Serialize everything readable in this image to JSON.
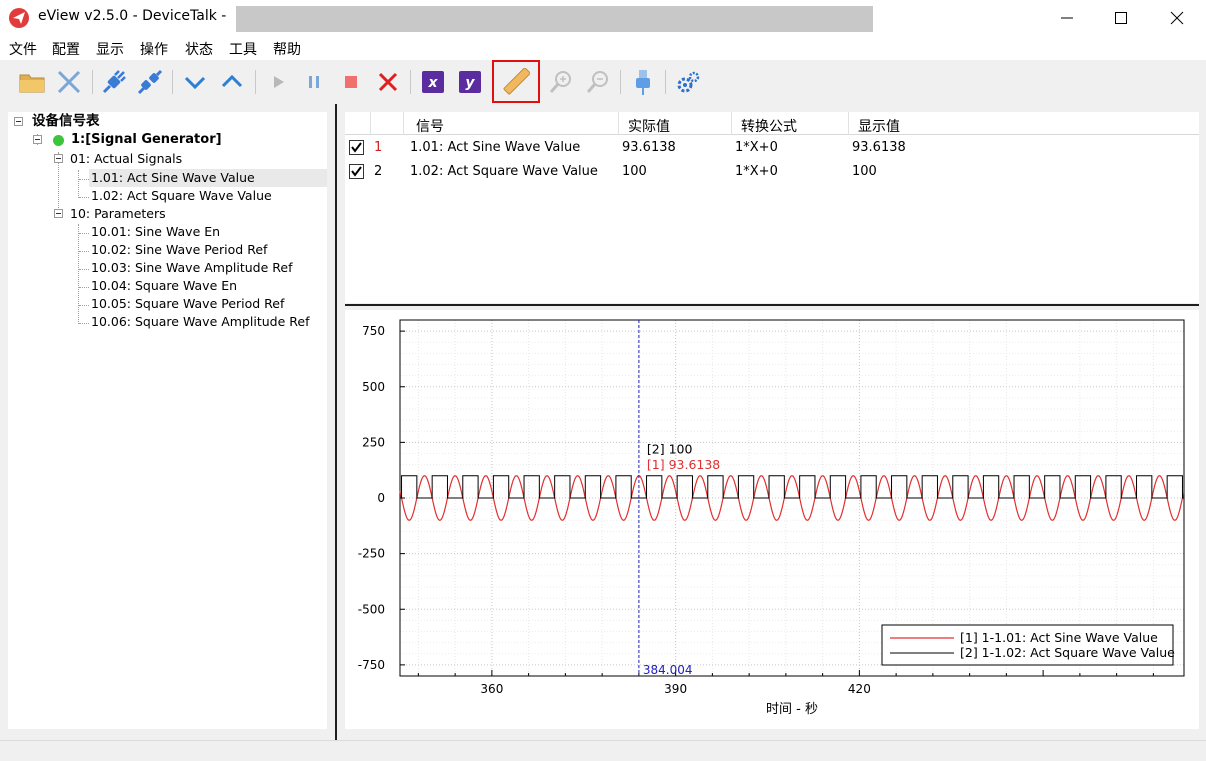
{
  "window": {
    "title": "eView v2.5.0 - DeviceTalk  -",
    "minimize_icon": "minimize-icon",
    "maximize_icon": "maximize-icon",
    "close_icon": "close-icon"
  },
  "menu": [
    "文件",
    "配置",
    "显示",
    "操作",
    "状态",
    "工具",
    "帮助"
  ],
  "toolbar": {
    "icons": [
      "open-folder-icon",
      "close-file-icon",
      "connect-icon",
      "disconnect-icon",
      "collapse-icon",
      "expand-icon",
      "play-icon",
      "pause-icon",
      "stop-icon",
      "delete-icon",
      "x-axis-icon",
      "y-axis-icon",
      "ruler-icon",
      "zoom-in-icon",
      "zoom-out-icon",
      "usb-icon",
      "settings-icon"
    ],
    "x_label": "x",
    "y_label": "y",
    "highlighted": "ruler-icon",
    "highlight_color": "#e01010"
  },
  "tree": {
    "root_label": "设备信号表",
    "device": {
      "label": "1:[Signal Generator]",
      "status_color": "#3cc43c"
    },
    "groups": [
      {
        "label": "01: Actual Signals",
        "items": [
          "1.01: Act Sine Wave Value",
          "1.02: Act Square Wave Value"
        ],
        "selected": "1.01: Act Sine Wave Value"
      },
      {
        "label": "10: Parameters",
        "items": [
          "10.01: Sine Wave En",
          "10.02: Sine Wave Period Ref",
          "10.03: Sine Wave Amplitude Ref",
          "10.04: Square Wave En",
          "10.05: Square Wave Period Ref",
          "10.06: Square Wave Amplitude Ref"
        ]
      }
    ]
  },
  "table": {
    "columns": [
      "信号",
      "实际值",
      "转换公式",
      "显示值"
    ],
    "rows": [
      {
        "checked": true,
        "index": "1",
        "index_color": "#d02020",
        "signal": "1.01: Act Sine Wave Value",
        "actual": "93.6138",
        "formula": "1*X+0",
        "display": "93.6138"
      },
      {
        "checked": true,
        "index": "2",
        "index_color": "#000000",
        "signal": "1.02: Act Square Wave Value",
        "actual": "100",
        "formula": "1*X+0",
        "display": "100"
      }
    ]
  },
  "chart_data": {
    "type": "line",
    "xlabel": "时间 - 秒",
    "ylabel": "",
    "xlim": [
      345,
      473
    ],
    "ylim": [
      -800,
      800
    ],
    "xticks": [
      360,
      390,
      420
    ],
    "yticks": [
      750,
      500,
      250,
      0,
      -250,
      -500,
      -750
    ],
    "grid": true,
    "series": [
      {
        "name": "[1] 1-1.01: Act Sine Wave Value",
        "color": "#e03030",
        "kind": "sine",
        "amplitude": 100,
        "period_s": 5,
        "mean": 0
      },
      {
        "name": "[2] 1-1.02: Act Square Wave Value",
        "color": "#000000",
        "kind": "square",
        "high": 100,
        "low": 0,
        "period_s": 5
      }
    ],
    "cursor": {
      "x": 384.004,
      "label": "384.004",
      "color": "#2020c0"
    },
    "cursor_values": [
      {
        "text": "[2] 100",
        "color": "#000000"
      },
      {
        "text": "[1] 93.6138",
        "color": "#e03030"
      }
    ],
    "legend_position": "bottom-right"
  }
}
